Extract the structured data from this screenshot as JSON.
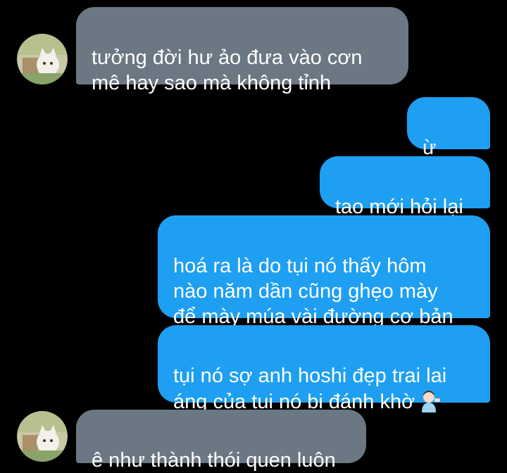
{
  "messages": [
    {
      "side": "in",
      "text": "tưởng đời hư ảo đưa vào cơn\nmê hay sao mà không tỉnh"
    },
    {
      "side": "out",
      "text": "ừ đấy"
    },
    {
      "side": "out",
      "text": "tao mới hỏi lại"
    },
    {
      "side": "out",
      "text": "hoá ra là do tụi nó thấy hôm\nnào năm dần cũng ghẹo mày\nđể mày múa vài đường cơ bản"
    },
    {
      "side": "out",
      "text": "tụi nó sợ anh hoshi đẹp trai lai\náng của tụi nó bị đánh khờ",
      "emoji": "person-tipping-hand-emoji"
    },
    {
      "side": "in",
      "text": "ê như thành thói quen luôn"
    }
  ],
  "colors": {
    "background": "#000000",
    "incoming_bubble": "#6b7884",
    "outgoing_bubble": "#1e9ff2",
    "text": "#ffffff"
  },
  "avatar": {
    "icon": "cat-avatar-icon"
  }
}
